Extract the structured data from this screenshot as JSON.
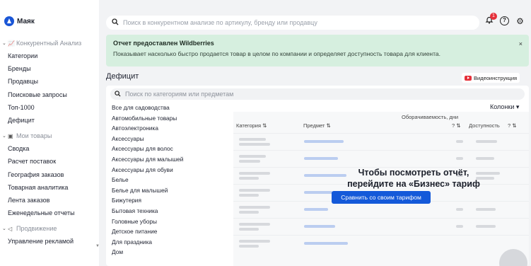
{
  "app": {
    "name": "Маяк"
  },
  "sidebar": {
    "groups": [
      {
        "label": "Конкурентный Анализ",
        "items": [
          "Категории",
          "Бренды",
          "Продавцы",
          "Поисковые запросы",
          "Топ-1000",
          "Дефицит"
        ]
      },
      {
        "label": "Мои товары",
        "items": [
          "Сводка",
          "Расчет поставок",
          "География заказов",
          "Товарная аналитика",
          "Лента заказов",
          "Еженедельные отчеты"
        ]
      },
      {
        "label": "Продвижение",
        "items": [
          "Управление рекламой"
        ]
      }
    ]
  },
  "topbar": {
    "search_placeholder": "Поиск в конкурентном анализе по артикулу, бренду или продавцу",
    "notifications_count": "1"
  },
  "banner": {
    "title": "Отчет предоставлен Wildberries",
    "text": "Показывает насколько быстро продается товар в целом по компании и определяет доступность товара для клиента.",
    "close": "×"
  },
  "section": {
    "title": "Дефицит",
    "video_label": "Видеоинструкция"
  },
  "panel": {
    "search_placeholder": "Поиск по категориям или предметам",
    "columns_label": "Колонки",
    "categories": [
      "Все для садоводства",
      "Автомобильные товары",
      "Автоэлектроника",
      "Аксессуары",
      "Аксессуары для волос",
      "Аксессуары для малышей",
      "Аксессуары для обуви",
      "Белье",
      "Белье для малышей",
      "Бижутерия",
      "Бытовая техника",
      "Головные уборы",
      "Детское питание",
      "Для праздника",
      "Дом"
    ],
    "table": {
      "headers": {
        "category": "Категория ⇅",
        "subject": "Предмет ⇅",
        "turnover": "Оборачиваемость, дни",
        "turnover_sort": "? ⇅",
        "availability": "Доступность",
        "availability_sort": "? ⇅"
      }
    },
    "overlay": {
      "line1": "Чтобы посмотреть отчёт,",
      "line2": "перейдите на «Бизнес» тариф",
      "cta": "Сравнить со своим тарифом"
    }
  },
  "colors": {
    "accent": "#1459d9",
    "banner_bg": "#d6efdf",
    "badge": "#e5303a"
  }
}
